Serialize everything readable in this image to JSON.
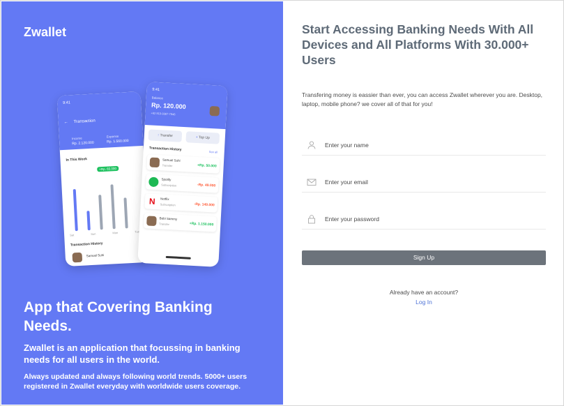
{
  "brand": "Zwallet",
  "hero": {
    "title": "App that Covering Banking Needs.",
    "description": "Zwallet is an application that focussing in banking needs for all users in the world.",
    "sub": "Always updated and always following world trends. 5000+ users registered in Zwallet everyday with worldwide users coverage."
  },
  "mockup": {
    "back": {
      "header": "Transaction",
      "income_label": "Income",
      "income_value": "Rp. 2.120.000",
      "expense_label": "Expense",
      "expense_value": "Rp. 1.560.000",
      "week_label": "In This Week",
      "badge": "+Rp. 65.000",
      "days": [
        "Sat",
        "Sun",
        "Mon",
        "Tue"
      ],
      "history_label": "Transaction History",
      "row_name": "Samuel Suhi"
    },
    "front": {
      "balance_label": "Balance",
      "balance": "Rp. 120.000",
      "phone": "+62 813-9387-7946",
      "transfer": "Transfer",
      "topup": "Top Up",
      "history_label": "Transaction History",
      "see_all": "See all",
      "rows": [
        {
          "name": "Samuel Suhi",
          "type": "Transfer",
          "amount": "+Rp. 50.000",
          "color": "#1ec15f"
        },
        {
          "name": "Spotify",
          "type": "Subscription",
          "amount": "-Rp. 49.000",
          "color": "#ff5b37"
        },
        {
          "name": "Netflix",
          "type": "Subscription",
          "amount": "-Rp. 149.000",
          "color": "#ff5b37"
        },
        {
          "name": "Bobi Sammy",
          "type": "Transfer",
          "amount": "+Rp. 1.150.000",
          "color": "#1ec15f"
        }
      ]
    }
  },
  "signup": {
    "title": "Start Accessing Banking Needs With All Devices and All Platforms With 30.000+ Users",
    "description": "Transfering money is eassier than ever, you can access Zwallet wherever you are. Desktop, laptop, mobile phone? we cover all of that for you!",
    "name_placeholder": "Enter your name",
    "email_placeholder": "Enter your email",
    "password_placeholder": "Enter your password",
    "signup_label": "Sign Up",
    "already_text": "Already have an account?",
    "login_label": "Log In"
  },
  "colors": {
    "accent": "#6379f4",
    "button": "#6c737b",
    "link": "#4d72d6"
  }
}
